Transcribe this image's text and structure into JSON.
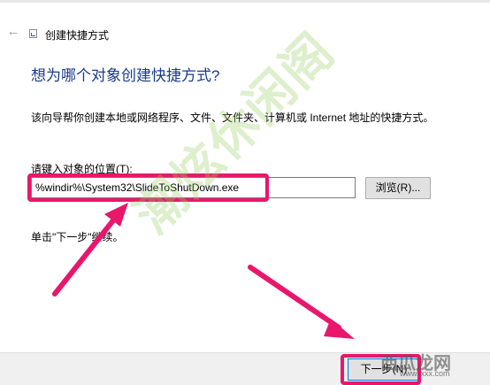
{
  "window": {
    "title": "创建快捷方式",
    "back_icon": "back-arrow-icon",
    "wizard_icon": "shortcut-wizard-icon"
  },
  "content": {
    "heading": "想为哪个对象创建快捷方式?",
    "description": "该向导帮你创建本地或网络程序、文件、文件夹、计算机或 Internet 地址的快捷方式。",
    "location_label": "请键入对象的位置(T):",
    "location_value": "%windir%\\System32\\SlideToShutDown.exe",
    "browse_label": "浏览(R)...",
    "hint": "单击\"下一步\"继续。"
  },
  "footer": {
    "next_label": "下一步(N)"
  },
  "watermark": {
    "text": "潮炫休闲阁",
    "logo": "西瓜龙网",
    "logo_url": "www.lxxx.com"
  },
  "annotation": {
    "highlight_color": "#e8176b",
    "arrow_color": "#e8176b"
  }
}
